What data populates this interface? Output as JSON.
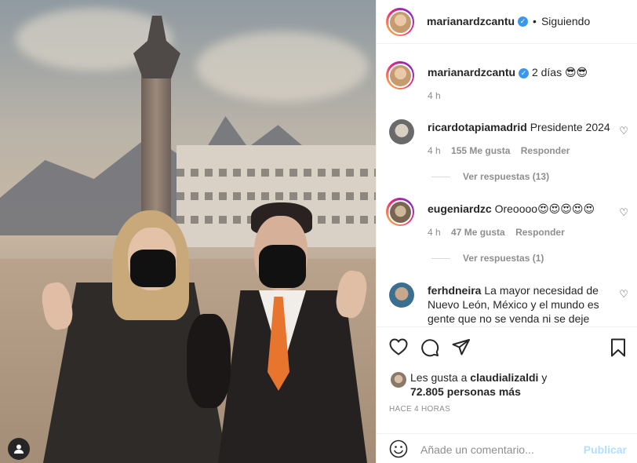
{
  "post": {
    "author": "marianardzcantu",
    "follow_status": "Siguiendo",
    "separator": "•",
    "caption": "2 días 😎😎",
    "caption_time": "4 h"
  },
  "comments": [
    {
      "user": "ricardotapiamadrid",
      "text": "Presidente 2024",
      "time": "4 h",
      "likes": "155 Me gusta",
      "reply": "Responder",
      "view_replies": "Ver respuestas (13)"
    },
    {
      "user": "eugeniardzc",
      "text": "Oreoooo😍😍😍😍😍",
      "time": "4 h",
      "likes": "47 Me gusta",
      "reply": "Responder",
      "view_replies": "Ver respuestas (1)"
    },
    {
      "user": "ferhdneira",
      "text": "La mayor necesidad de Nuevo León, México y el mundo es gente que no se venda ni se deje"
    }
  ],
  "likes": {
    "prefix": "Les gusta a",
    "liked_by": "claudializaldi",
    "connector": "y",
    "count": "72.805 personas más"
  },
  "time_ago": "HACE 4 HORAS",
  "add_comment": {
    "placeholder": "Añade un comentario...",
    "publish": "Publicar"
  },
  "icons": {
    "like": "heart-icon",
    "comment": "comment-icon",
    "share": "share-icon",
    "save": "bookmark-icon",
    "emoji": "emoji-icon",
    "user_tag": "user-tag-icon",
    "verified": "verified-badge-icon"
  },
  "colors": {
    "verified": "#3897f0",
    "publish_disabled": "#b2dffc",
    "secondary_text": "#8e8e8e"
  }
}
